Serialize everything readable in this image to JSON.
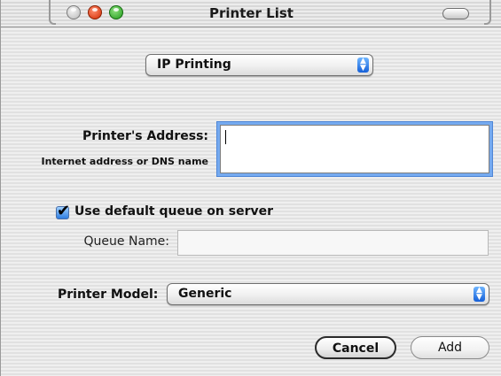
{
  "window": {
    "title": "Printer List"
  },
  "connection_popup": {
    "selected": "IP Printing"
  },
  "address": {
    "label": "Printer's Address:",
    "hint": "Internet address or DNS name",
    "value": ""
  },
  "queue": {
    "checkbox_label": "Use default queue on server",
    "checked": true,
    "name_label": "Queue Name:",
    "name_value": ""
  },
  "model": {
    "label": "Printer Model:",
    "selected": "Generic"
  },
  "buttons": {
    "cancel": "Cancel",
    "add": "Add"
  },
  "icons": {
    "checkmark": "✔",
    "popup_arrows_up": "▲",
    "popup_arrows_down": "▼"
  }
}
